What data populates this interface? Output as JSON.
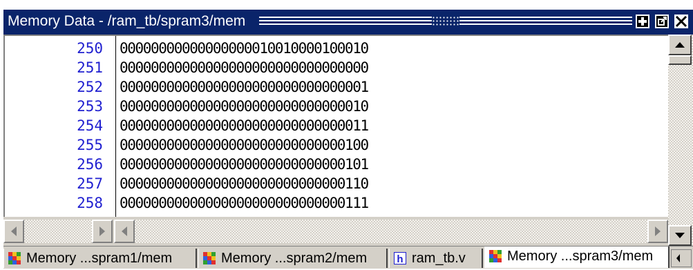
{
  "window": {
    "title": "Memory Data - /ram_tb/spram3/mem",
    "buttons": [
      "dock-icon",
      "undock-icon",
      "close-icon"
    ]
  },
  "memory": {
    "rows": [
      {
        "address": "250",
        "value": "00000000000000000010010000100010"
      },
      {
        "address": "251",
        "value": "00000000000000000000000000000000"
      },
      {
        "address": "252",
        "value": "00000000000000000000000000000001"
      },
      {
        "address": "253",
        "value": "00000000000000000000000000000010"
      },
      {
        "address": "254",
        "value": "00000000000000000000000000000011"
      },
      {
        "address": "255",
        "value": "00000000000000000000000000000100"
      },
      {
        "address": "256",
        "value": "00000000000000000000000000000101"
      },
      {
        "address": "257",
        "value": "00000000000000000000000000000110"
      },
      {
        "address": "258",
        "value": "00000000000000000000000000000111"
      }
    ]
  },
  "tabs": [
    {
      "label": "Memory ...spram1/mem",
      "icon": "memory-grid-icon",
      "active": false
    },
    {
      "label": "Memory ...spram2/mem",
      "icon": "memory-grid-icon",
      "active": false
    },
    {
      "label": "ram_tb.v",
      "icon": "verilog-file-icon",
      "active": false
    },
    {
      "label": "Memory ...spram3/mem",
      "icon": "memory-grid-icon",
      "active": true
    }
  ],
  "colors": {
    "titlebar": "#0a246a",
    "address_text": "#1f1fd0",
    "chrome": "#d4d0c8"
  }
}
